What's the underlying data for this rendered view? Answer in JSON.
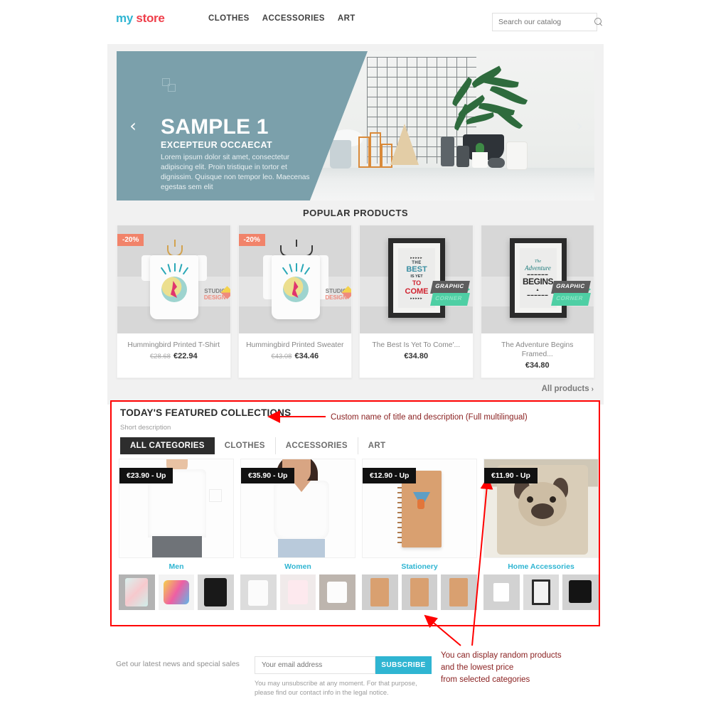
{
  "header": {
    "logo": {
      "part1": "my",
      "part2": "store"
    },
    "nav": [
      {
        "label": "CLOTHES"
      },
      {
        "label": "ACCESSORIES"
      },
      {
        "label": "ART"
      }
    ],
    "search": {
      "placeholder": "Search our catalog",
      "value": "",
      "icon": "search-icon"
    }
  },
  "banner": {
    "title": "SAMPLE 1",
    "subtitle": "EXCEPTEUR OCCAECAT",
    "text": "Lorem ipsum dolor sit amet, consectetur adipiscing elit. Proin tristique in tortor et dignissim. Quisque non tempor leo. Maecenas egestas sem elit",
    "prev_icon": "chevron-left-icon",
    "next_icon": "chevron-right-icon",
    "panel_color": "#7ba0ab",
    "decor_icon": "two-squares-icon"
  },
  "popular": {
    "heading": "POPULAR PRODUCTS",
    "all_products_label": "All products",
    "all_products_chevron": "›",
    "products": [
      {
        "name": "Hummingbird Printed T-Shirt",
        "old_price": "€28.68",
        "price": "€22.94",
        "badge": "-20%",
        "studio_top": "STUDIO",
        "studio_bottom": "DESIGN"
      },
      {
        "name": "Hummingbird Printed Sweater",
        "old_price": "€43.08",
        "price": "€34.46",
        "badge": "-20%",
        "studio_top": "STUDIO",
        "studio_bottom": "DESIGN"
      },
      {
        "name": "The Best Is Yet To Come'...",
        "old_price": "",
        "price": "€34.80",
        "badge": "",
        "art_line1": "THE",
        "art_line2": "BEST",
        "art_line3": "IS YET",
        "art_line4": "TO",
        "art_line5": "COME",
        "corner_top": "GRAPHIC",
        "corner_bottom": "CORNER"
      },
      {
        "name": "The Adventure Begins Framed...",
        "old_price": "",
        "price": "€34.80",
        "badge": "",
        "art_line1": "The",
        "art_line2": "Adventure",
        "art_line3": "BEGINS",
        "corner_top": "GRAPHIC",
        "corner_bottom": "CORNER"
      }
    ]
  },
  "featured": {
    "title": "TODAY'S FEATURED COLLECTIONS",
    "description": "Short description",
    "tabs": [
      {
        "label": "ALL CATEGORIES",
        "active": true
      },
      {
        "label": "CLOTHES",
        "active": false
      },
      {
        "label": "ACCESSORIES",
        "active": false
      },
      {
        "label": "ART",
        "active": false
      }
    ],
    "categories": [
      {
        "name": "Men",
        "price": "€23.90 - Up"
      },
      {
        "name": "Women",
        "price": "€35.90 - Up"
      },
      {
        "name": "Stationery",
        "price": "€12.90 - Up"
      },
      {
        "name": "Home Accessories",
        "price": "€11.90 - Up"
      }
    ],
    "accent_color": "#2fb5d2",
    "highlight_color": "#ff0000"
  },
  "newsletter": {
    "label": "Get our latest news and special sales",
    "placeholder": "Your email address",
    "value": "",
    "button": "SUBSCRIBE",
    "note": "You may unsubscribe at any moment. For that purpose, please find our contact info in the legal notice."
  },
  "annotations": {
    "one": "Custom name of title and description (Full multilingual)",
    "two_line1": "You can display random products",
    "two_line2": "and the lowest price",
    "two_line3": "from selected categories",
    "color": "#8b2222",
    "arrow_color": "#ff0000"
  }
}
